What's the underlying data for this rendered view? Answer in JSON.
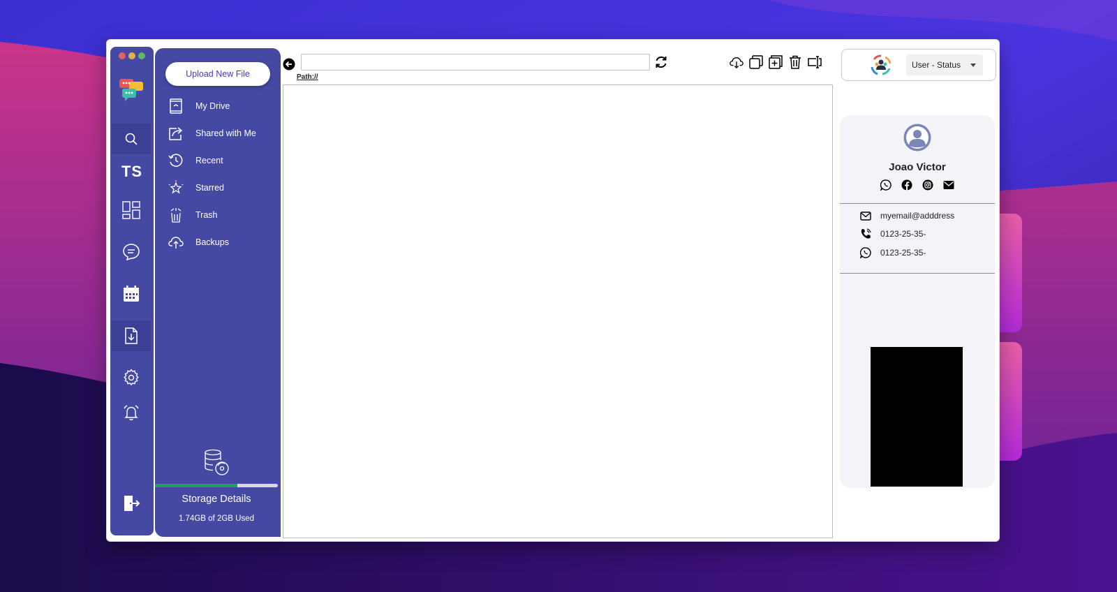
{
  "window": {
    "traffic_lights": [
      "#e0645f",
      "#dfb24a",
      "#5fb764"
    ]
  },
  "rail": {
    "brand_text": "TS",
    "items": [
      {
        "icon": "chat-bubbles-logo"
      },
      {
        "icon": "search-icon"
      },
      {
        "icon": "dashboard-icon"
      },
      {
        "icon": "chat-icon"
      },
      {
        "icon": "calendar-icon"
      },
      {
        "icon": "file-download-icon"
      },
      {
        "icon": "gear-icon"
      },
      {
        "icon": "alarm-bell-icon"
      },
      {
        "icon": "logout-icon"
      }
    ]
  },
  "sidebar": {
    "upload_label": "Upload New File",
    "items": [
      {
        "label": "My Drive",
        "icon": "drive-icon"
      },
      {
        "label": "Shared with Me",
        "icon": "share-icon"
      },
      {
        "label": "Recent",
        "icon": "history-icon"
      },
      {
        "label": "Starred",
        "icon": "star-icon"
      },
      {
        "label": "Trash",
        "icon": "trash-icon"
      },
      {
        "label": "Backups",
        "icon": "cloud-upload-icon"
      }
    ],
    "storage": {
      "title": "Storage Details",
      "used_text": "1.74GB of 2GB Used",
      "used_fraction": 0.67,
      "bar_color": "#1fa15a"
    }
  },
  "toolbar": {
    "path_value": "",
    "path_label": "Path://",
    "tools": [
      "cloud-download-icon",
      "copy-icon",
      "add-icon",
      "delete-icon",
      "rename-icon"
    ]
  },
  "user_header": {
    "status_label": "User - Status"
  },
  "profile": {
    "name": "Joao Victor",
    "socials": [
      "whatsapp-icon",
      "facebook-icon",
      "instagram-icon",
      "email-icon"
    ],
    "email": "myemail@adddress",
    "phone": "0123-25-35-",
    "whatsapp": "0123-25-35-"
  },
  "colors": {
    "accent": "#4649a3",
    "accent_dark": "#3c3f93",
    "upload_text": "#4a36c8"
  }
}
